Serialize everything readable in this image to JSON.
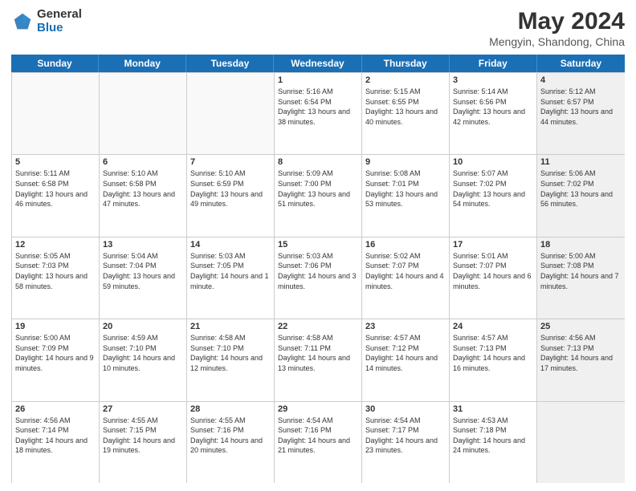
{
  "logo": {
    "general": "General",
    "blue": "Blue"
  },
  "title": "May 2024",
  "subtitle": "Mengyin, Shandong, China",
  "days_of_week": [
    "Sunday",
    "Monday",
    "Tuesday",
    "Wednesday",
    "Thursday",
    "Friday",
    "Saturday"
  ],
  "weeks": [
    [
      {
        "day": "",
        "empty": true
      },
      {
        "day": "",
        "empty": true
      },
      {
        "day": "",
        "empty": true
      },
      {
        "day": "1",
        "sunrise": "Sunrise: 5:16 AM",
        "sunset": "Sunset: 6:54 PM",
        "daylight": "Daylight: 13 hours and 38 minutes."
      },
      {
        "day": "2",
        "sunrise": "Sunrise: 5:15 AM",
        "sunset": "Sunset: 6:55 PM",
        "daylight": "Daylight: 13 hours and 40 minutes."
      },
      {
        "day": "3",
        "sunrise": "Sunrise: 5:14 AM",
        "sunset": "Sunset: 6:56 PM",
        "daylight": "Daylight: 13 hours and 42 minutes."
      },
      {
        "day": "4",
        "sunrise": "Sunrise: 5:12 AM",
        "sunset": "Sunset: 6:57 PM",
        "daylight": "Daylight: 13 hours and 44 minutes.",
        "shaded": true
      }
    ],
    [
      {
        "day": "5",
        "sunrise": "Sunrise: 5:11 AM",
        "sunset": "Sunset: 6:58 PM",
        "daylight": "Daylight: 13 hours and 46 minutes."
      },
      {
        "day": "6",
        "sunrise": "Sunrise: 5:10 AM",
        "sunset": "Sunset: 6:58 PM",
        "daylight": "Daylight: 13 hours and 47 minutes."
      },
      {
        "day": "7",
        "sunrise": "Sunrise: 5:10 AM",
        "sunset": "Sunset: 6:59 PM",
        "daylight": "Daylight: 13 hours and 49 minutes."
      },
      {
        "day": "8",
        "sunrise": "Sunrise: 5:09 AM",
        "sunset": "Sunset: 7:00 PM",
        "daylight": "Daylight: 13 hours and 51 minutes."
      },
      {
        "day": "9",
        "sunrise": "Sunrise: 5:08 AM",
        "sunset": "Sunset: 7:01 PM",
        "daylight": "Daylight: 13 hours and 53 minutes."
      },
      {
        "day": "10",
        "sunrise": "Sunrise: 5:07 AM",
        "sunset": "Sunset: 7:02 PM",
        "daylight": "Daylight: 13 hours and 54 minutes."
      },
      {
        "day": "11",
        "sunrise": "Sunrise: 5:06 AM",
        "sunset": "Sunset: 7:02 PM",
        "daylight": "Daylight: 13 hours and 56 minutes.",
        "shaded": true
      }
    ],
    [
      {
        "day": "12",
        "sunrise": "Sunrise: 5:05 AM",
        "sunset": "Sunset: 7:03 PM",
        "daylight": "Daylight: 13 hours and 58 minutes."
      },
      {
        "day": "13",
        "sunrise": "Sunrise: 5:04 AM",
        "sunset": "Sunset: 7:04 PM",
        "daylight": "Daylight: 13 hours and 59 minutes."
      },
      {
        "day": "14",
        "sunrise": "Sunrise: 5:03 AM",
        "sunset": "Sunset: 7:05 PM",
        "daylight": "Daylight: 14 hours and 1 minute."
      },
      {
        "day": "15",
        "sunrise": "Sunrise: 5:03 AM",
        "sunset": "Sunset: 7:06 PM",
        "daylight": "Daylight: 14 hours and 3 minutes."
      },
      {
        "day": "16",
        "sunrise": "Sunrise: 5:02 AM",
        "sunset": "Sunset: 7:07 PM",
        "daylight": "Daylight: 14 hours and 4 minutes."
      },
      {
        "day": "17",
        "sunrise": "Sunrise: 5:01 AM",
        "sunset": "Sunset: 7:07 PM",
        "daylight": "Daylight: 14 hours and 6 minutes."
      },
      {
        "day": "18",
        "sunrise": "Sunrise: 5:00 AM",
        "sunset": "Sunset: 7:08 PM",
        "daylight": "Daylight: 14 hours and 7 minutes.",
        "shaded": true
      }
    ],
    [
      {
        "day": "19",
        "sunrise": "Sunrise: 5:00 AM",
        "sunset": "Sunset: 7:09 PM",
        "daylight": "Daylight: 14 hours and 9 minutes."
      },
      {
        "day": "20",
        "sunrise": "Sunrise: 4:59 AM",
        "sunset": "Sunset: 7:10 PM",
        "daylight": "Daylight: 14 hours and 10 minutes."
      },
      {
        "day": "21",
        "sunrise": "Sunrise: 4:58 AM",
        "sunset": "Sunset: 7:10 PM",
        "daylight": "Daylight: 14 hours and 12 minutes."
      },
      {
        "day": "22",
        "sunrise": "Sunrise: 4:58 AM",
        "sunset": "Sunset: 7:11 PM",
        "daylight": "Daylight: 14 hours and 13 minutes."
      },
      {
        "day": "23",
        "sunrise": "Sunrise: 4:57 AM",
        "sunset": "Sunset: 7:12 PM",
        "daylight": "Daylight: 14 hours and 14 minutes."
      },
      {
        "day": "24",
        "sunrise": "Sunrise: 4:57 AM",
        "sunset": "Sunset: 7:13 PM",
        "daylight": "Daylight: 14 hours and 16 minutes."
      },
      {
        "day": "25",
        "sunrise": "Sunrise: 4:56 AM",
        "sunset": "Sunset: 7:13 PM",
        "daylight": "Daylight: 14 hours and 17 minutes.",
        "shaded": true
      }
    ],
    [
      {
        "day": "26",
        "sunrise": "Sunrise: 4:56 AM",
        "sunset": "Sunset: 7:14 PM",
        "daylight": "Daylight: 14 hours and 18 minutes."
      },
      {
        "day": "27",
        "sunrise": "Sunrise: 4:55 AM",
        "sunset": "Sunset: 7:15 PM",
        "daylight": "Daylight: 14 hours and 19 minutes."
      },
      {
        "day": "28",
        "sunrise": "Sunrise: 4:55 AM",
        "sunset": "Sunset: 7:16 PM",
        "daylight": "Daylight: 14 hours and 20 minutes."
      },
      {
        "day": "29",
        "sunrise": "Sunrise: 4:54 AM",
        "sunset": "Sunset: 7:16 PM",
        "daylight": "Daylight: 14 hours and 21 minutes."
      },
      {
        "day": "30",
        "sunrise": "Sunrise: 4:54 AM",
        "sunset": "Sunset: 7:17 PM",
        "daylight": "Daylight: 14 hours and 23 minutes."
      },
      {
        "day": "31",
        "sunrise": "Sunrise: 4:53 AM",
        "sunset": "Sunset: 7:18 PM",
        "daylight": "Daylight: 14 hours and 24 minutes."
      },
      {
        "day": "",
        "empty": true,
        "shaded": true
      }
    ]
  ]
}
